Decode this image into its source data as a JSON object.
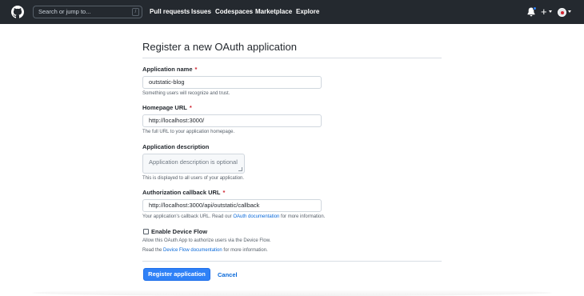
{
  "header": {
    "logo_icon": "github-logo-icon",
    "search": {
      "placeholder": "Search or jump to...",
      "shortcut": "/"
    },
    "nav": [
      "Pull requests",
      "Issues",
      "Codespaces",
      "Marketplace",
      "Explore"
    ],
    "notification_icon": "bell-icon",
    "create_icon": "plus-icon",
    "create_label": "+",
    "avatar_icon": "avatar"
  },
  "page": {
    "title": "Register a new OAuth application"
  },
  "form": {
    "app_name": {
      "label": "Application name",
      "required_mark": "*",
      "value": "outstatic-blog",
      "note": "Something users will recognize and trust."
    },
    "homepage_url": {
      "label": "Homepage URL",
      "required_mark": "*",
      "value": "http://localhost:3000/",
      "note": "The full URL to your application homepage."
    },
    "description": {
      "label": "Application description",
      "placeholder": "Application description is optional",
      "note": "This is displayed to all users of your application."
    },
    "callback_url": {
      "label": "Authorization callback URL",
      "required_mark": "*",
      "value": "http://localhost:3000/api/outstatic/callback",
      "note_prefix": "Your application's callback URL. Read our",
      "note_link": "OAuth documentation",
      "note_suffix": "for more information."
    },
    "device_flow": {
      "label": "Enable Device Flow",
      "checked": false,
      "note_line1": "Allow this OAuth App to authorize users via the Device Flow.",
      "note_prefix": "Read the",
      "note_link": "Device Flow documentation",
      "note_suffix": "for more information."
    },
    "submit_label": "Register application",
    "cancel_label": "Cancel"
  },
  "colors": {
    "header_bg": "#24292f",
    "primary_button": "#2f81f7",
    "link": "#0969da",
    "required": "#cf222e"
  }
}
